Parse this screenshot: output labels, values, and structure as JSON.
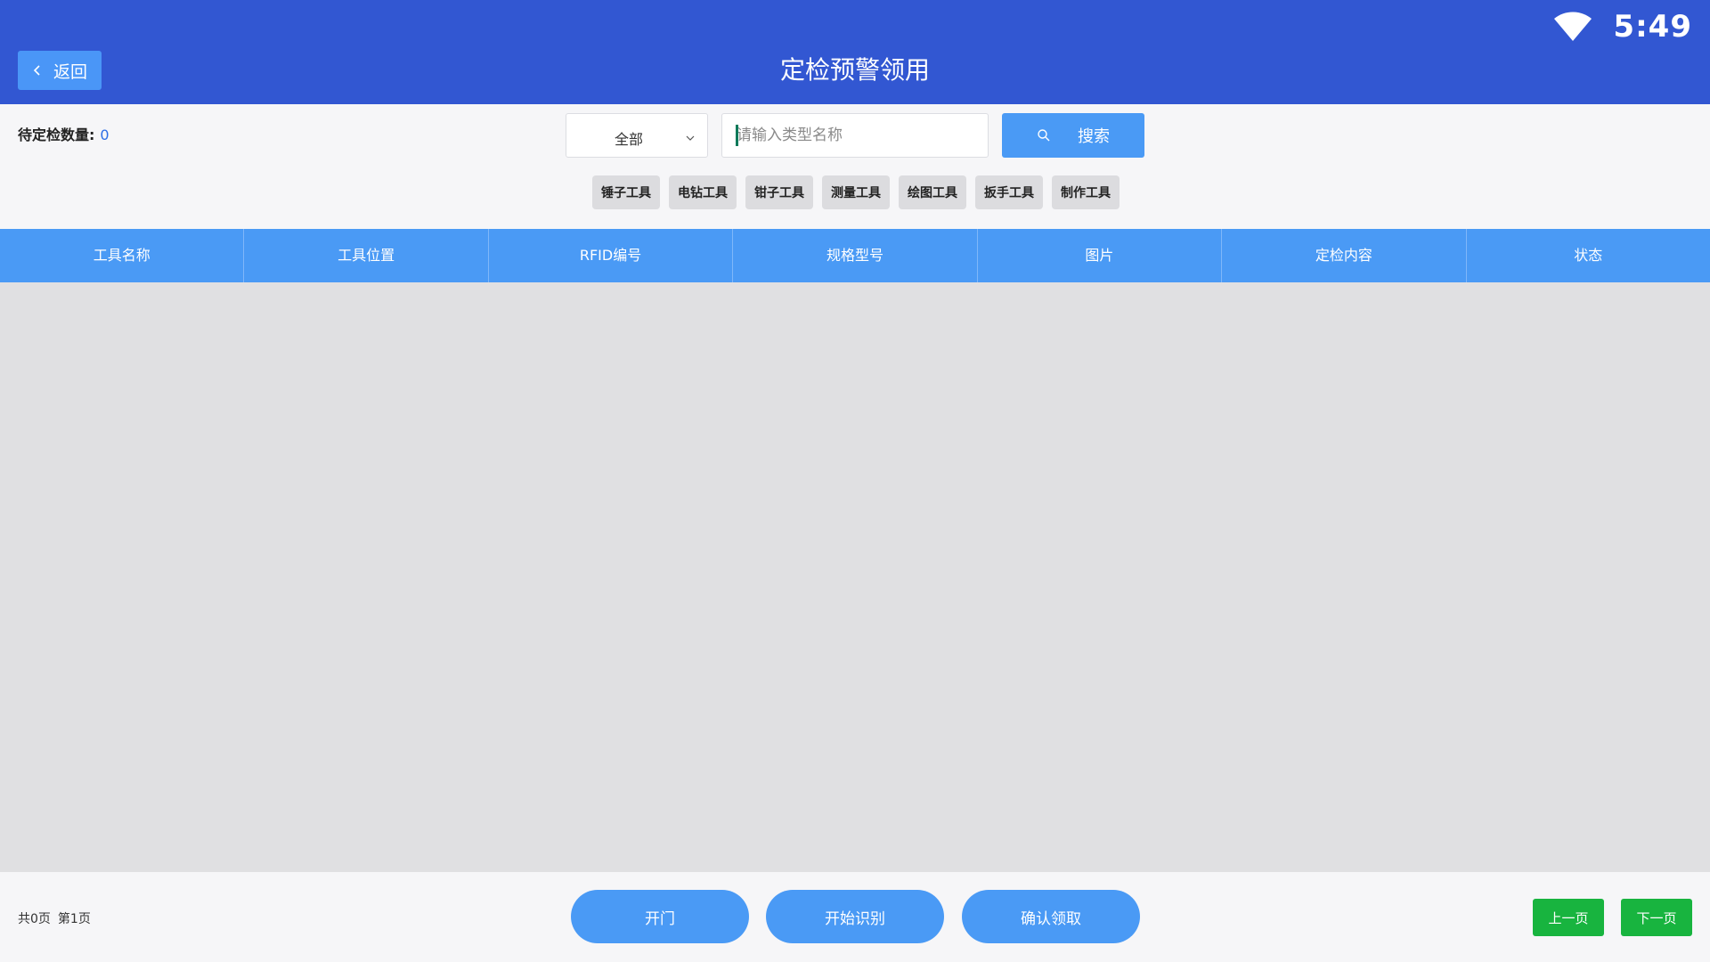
{
  "status_bar": {
    "time": "5:49",
    "wifi_icon": "wifi-icon"
  },
  "header": {
    "back_label": "返回",
    "title": "定检预警领用"
  },
  "toolbar": {
    "pending_label": "待定检数量:",
    "pending_count": "0",
    "category_select": {
      "selected": "全部"
    },
    "search": {
      "placeholder": "请输入类型名称",
      "value": ""
    },
    "search_button_label": "搜索",
    "categories": [
      "锤子工具",
      "电钻工具",
      "钳子工具",
      "测量工具",
      "绘图工具",
      "扳手工具",
      "制作工具"
    ]
  },
  "table": {
    "columns": [
      "工具名称",
      "工具位置",
      "RFID编号",
      "规格型号",
      "图片",
      "定检内容",
      "状态"
    ],
    "rows": []
  },
  "footer": {
    "total_pages": "共0页",
    "current_page": "第1页",
    "open_door_label": "开门",
    "start_scan_label": "开始识别",
    "confirm_label": "确认领取",
    "prev_label": "上一页",
    "next_label": "下一页"
  },
  "colors": {
    "header_bg": "#3257d2",
    "accent_blue": "#4a9af5",
    "green": "#18b43f",
    "table_body_bg": "#e0e0e2"
  }
}
